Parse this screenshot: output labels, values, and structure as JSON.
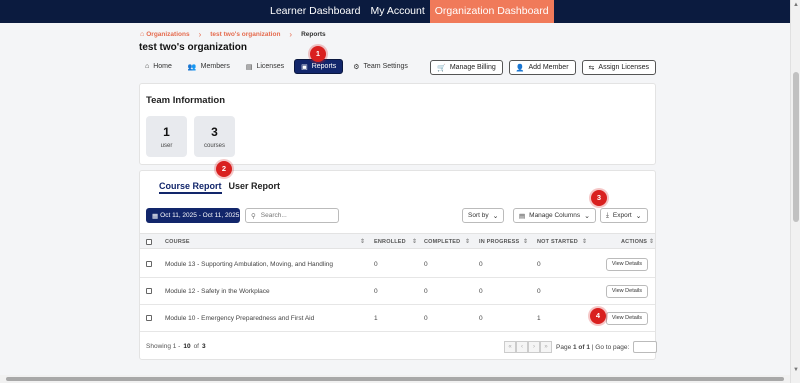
{
  "topnav": {
    "items": [
      {
        "label": "Learner Dashboard"
      },
      {
        "label": "My Account"
      },
      {
        "label": "Organization Dashboard"
      }
    ]
  },
  "breadcrumb": {
    "items": [
      {
        "label": "Organizations"
      },
      {
        "label": "test two's organization"
      },
      {
        "label": "Reports"
      }
    ]
  },
  "org_title": "test two's organization",
  "tabs": [
    {
      "label": "Home",
      "icon": "home-icon"
    },
    {
      "label": "Members",
      "icon": "users-icon"
    },
    {
      "label": "Licenses",
      "icon": "document-icon"
    },
    {
      "label": "Reports",
      "icon": "chart-icon"
    },
    {
      "label": "Team Settings",
      "icon": "gear-icon"
    }
  ],
  "actions": {
    "manage_billing": "Manage Billing",
    "add_member": "Add Member",
    "assign_licenses": "Assign Licenses"
  },
  "team_info": {
    "title": "Team Information",
    "stats": [
      {
        "value": "1",
        "label": "user"
      },
      {
        "value": "3",
        "label": "courses"
      }
    ]
  },
  "report": {
    "tabs": [
      {
        "label": "Course Report"
      },
      {
        "label": "User Report"
      }
    ],
    "date_range": "Oct 11, 2025 - Oct 11, 2025",
    "search_placeholder": "Search...",
    "sort_by": "Sort by",
    "manage_columns": "Manage Columns",
    "export": "Export",
    "columns": [
      "COURSE",
      "ENROLLED",
      "COMPLETED",
      "IN PROGRESS",
      "NOT STARTED",
      "ACTIONS"
    ],
    "rows": [
      {
        "course": "Module 13 - Supporting Ambulation, Moving, and Handling",
        "enrolled": "0",
        "completed": "0",
        "in_progress": "0",
        "not_started": "0",
        "action": "View Details"
      },
      {
        "course": "Module 12 - Safety in the Workplace",
        "enrolled": "0",
        "completed": "0",
        "in_progress": "0",
        "not_started": "0",
        "action": "View Details"
      },
      {
        "course": "Module 10 - Emergency Preparedness and First Aid",
        "enrolled": "1",
        "completed": "0",
        "in_progress": "0",
        "not_started": "1",
        "action": "View Details"
      }
    ],
    "footer": {
      "showing": "Showing 1 -",
      "page_size": "10",
      "of": "of",
      "total": "3"
    },
    "pager": {
      "page_label": "Page",
      "page_current": "1 of 1",
      "go_to": "| Go to page:"
    }
  },
  "markers": [
    "1",
    "2",
    "3",
    "4"
  ],
  "colors": {
    "navbar": "#0b1b3f",
    "accent": "#f07a5a",
    "primary": "#12266b",
    "marker": "#d9201f"
  }
}
